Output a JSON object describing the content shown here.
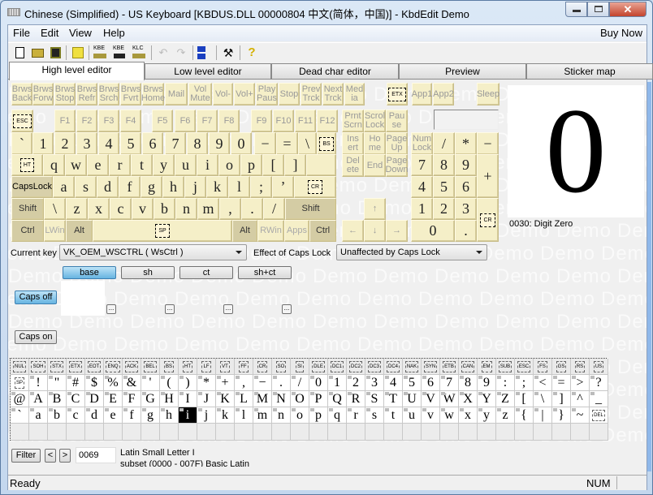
{
  "window": {
    "title": "Chinese (Simplified) - US Keyboard [KBDUS.DLL 00000804 中文(简体，中国)] - KbdEdit Demo",
    "close_glyph": "✕"
  },
  "menu": {
    "items": [
      "File",
      "Edit",
      "View",
      "Help"
    ],
    "buy_now": "Buy Now"
  },
  "toolbar": {
    "kbe1": "KBE",
    "kbe2": "KBE",
    "klc": "KLC",
    "help": "?"
  },
  "tabs": [
    "High level editor",
    "Low level editor",
    "Dead char editor",
    "Preview",
    "Sticker map"
  ],
  "watermark": "Demo",
  "keyboard": {
    "media": [
      "Brws Back",
      "Brws Forw",
      "Brws Stop",
      "Brws Refr",
      "Brws Srch",
      "Brws Fvrt",
      "Brws Home",
      "Mail",
      "Vol Mute",
      "Vol-",
      "Vol+",
      "Play Paus",
      "Stop",
      "Prev Trck",
      "Next Trck",
      "Med ia",
      "ETX",
      "App1",
      "App2",
      "Sleep"
    ],
    "fn_row": [
      "ESC",
      "F1",
      "F2",
      "F3",
      "F4",
      "F5",
      "F6",
      "F7",
      "F8",
      "F9",
      "F10",
      "F11",
      "F12",
      "Prnt Scrn",
      "Scrol Lock",
      "Pau se"
    ],
    "num_row": [
      "`",
      "1",
      "2",
      "3",
      "4",
      "5",
      "6",
      "7",
      "8",
      "9",
      "0",
      "−",
      "=",
      "\\",
      "BS"
    ],
    "q_row": [
      "HT",
      "q",
      "w",
      "e",
      "r",
      "t",
      "y",
      "u",
      "i",
      "o",
      "p",
      "[",
      "]"
    ],
    "a_row": [
      "CapsLock",
      "a",
      "s",
      "d",
      "f",
      "g",
      "h",
      "j",
      "k",
      "l",
      ";",
      "’",
      "CR"
    ],
    "z_row": [
      "Shift",
      "\\",
      "z",
      "x",
      "c",
      "v",
      "b",
      "n",
      "m",
      ",",
      ".",
      "/",
      "Shift"
    ],
    "bottom_row": [
      "Ctrl",
      "LWin",
      "Alt",
      "SP",
      "Alt",
      "RWin",
      "Apps",
      "Ctrl"
    ],
    "nav": [
      "Ins ert",
      "Ho me",
      "Page Up",
      "Del ete",
      "End",
      "Page Down",
      "↑",
      "←",
      "↓",
      "→"
    ],
    "numpad": [
      "Num Lock",
      "/",
      "*",
      "−",
      "7",
      "8",
      "9",
      "+",
      "4",
      "5",
      "6",
      "1",
      "2",
      "3",
      "CR",
      "0",
      "."
    ]
  },
  "preview": {
    "char": "0",
    "label": "0030: Digit Zero"
  },
  "current_key": {
    "label": "Current key",
    "value": "VK_OEM_WSCTRL ( WsCtrl )"
  },
  "caps_effect": {
    "label": "Effect of Caps Lock",
    "value": "Unaffected by Caps Lock"
  },
  "shift_states": [
    "base",
    "sh",
    "ct",
    "sh+ct"
  ],
  "caps_off": "Caps off",
  "caps_on": "Caps on",
  "ellipsis": "...",
  "charmap": {
    "rows": [
      [
        "NUL",
        "SOH",
        "STX",
        "ETX",
        "EOT",
        "ENQ",
        "ACK",
        "BEL",
        "BS",
        "HT",
        "LF",
        "VT",
        "FF",
        "CR",
        "SO",
        "SI",
        "DLE",
        "DC1",
        "DC2",
        "DC3",
        "DC4",
        "NAK",
        "SYN",
        "ETB",
        "CAN",
        "EM",
        "SUB",
        "ESC",
        "FS",
        "GS",
        "RS",
        "US"
      ],
      [
        "SP",
        "!",
        "\"",
        "#",
        "$",
        "%",
        "&",
        "'",
        "(",
        ")",
        "*",
        "+",
        ",",
        "−",
        ".",
        "/",
        "0",
        "1",
        "2",
        "3",
        "4",
        "5",
        "6",
        "7",
        "8",
        "9",
        ":",
        ";",
        "<",
        "=",
        ">",
        "?"
      ],
      [
        "@",
        "A",
        "B",
        "C",
        "D",
        "E",
        "F",
        "G",
        "H",
        "I",
        "J",
        "K",
        "L",
        "M",
        "N",
        "O",
        "P",
        "Q",
        "R",
        "S",
        "T",
        "U",
        "V",
        "W",
        "X",
        "Y",
        "Z",
        "[",
        "\\",
        "]",
        "^",
        "_"
      ],
      [
        "`",
        "a",
        "b",
        "c",
        "d",
        "e",
        "f",
        "g",
        "h",
        "i",
        "j",
        "k",
        "l",
        "m",
        "n",
        "o",
        "p",
        "q",
        "r",
        "s",
        "t",
        "u",
        "v",
        "w",
        "x",
        "y",
        "z",
        "{",
        "|",
        "}",
        "~",
        "DEL"
      ]
    ],
    "selected": "i"
  },
  "filter": {
    "button": "Filter",
    "prev": "<",
    "next": ">",
    "code": "0069",
    "name": "Latin Small Letter I",
    "subset": "subset (0000 - 007F) Basic Latin"
  },
  "status": {
    "text": "Ready",
    "num": "NUM"
  }
}
